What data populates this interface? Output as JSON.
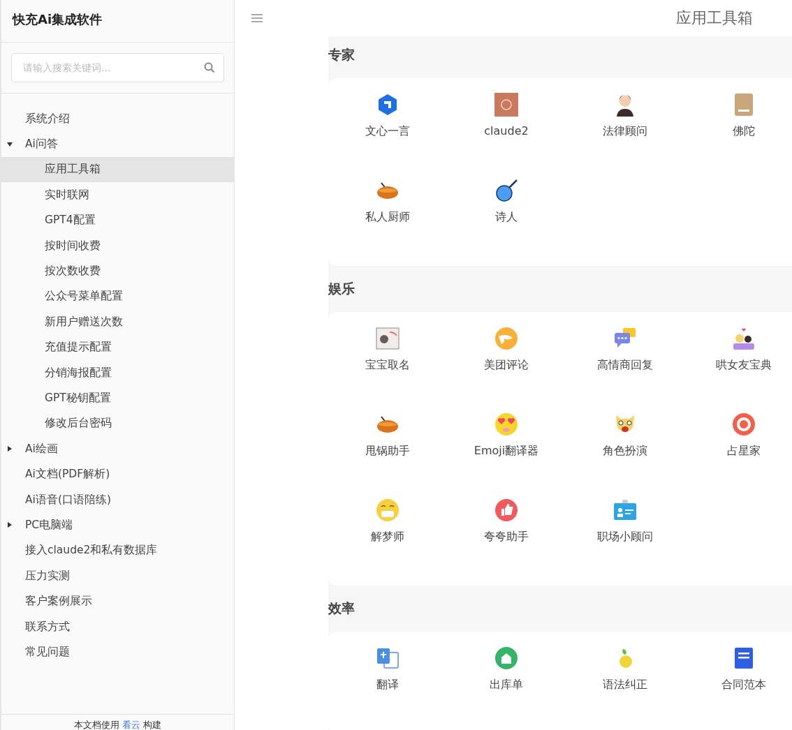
{
  "brand": "快充Ai集成软件",
  "search": {
    "placeholder": "请输入搜索关键词..."
  },
  "nav": [
    {
      "kind": "link",
      "label": "系统介绍",
      "selected": false
    },
    {
      "kind": "group",
      "label": "Ai问答",
      "selected": false,
      "expanded": true,
      "children": [
        {
          "label": "应用工具箱",
          "selected": true
        },
        {
          "label": "实时联网",
          "selected": false
        },
        {
          "label": "GPT4配置",
          "selected": false
        },
        {
          "label": "按时间收费",
          "selected": false
        },
        {
          "label": "按次数收费",
          "selected": false
        },
        {
          "label": "公众号菜单配置",
          "selected": false
        },
        {
          "label": "新用户赠送次数",
          "selected": false
        },
        {
          "label": "充值提示配置",
          "selected": false
        },
        {
          "label": "分销海报配置",
          "selected": false
        },
        {
          "label": "GPT秘钥配置",
          "selected": false
        },
        {
          "label": "修改后台密码",
          "selected": false
        }
      ]
    },
    {
      "kind": "group",
      "label": "Ai绘画",
      "selected": false,
      "expanded": false
    },
    {
      "kind": "link",
      "label": "Ai文档(PDF解析)",
      "selected": false
    },
    {
      "kind": "link",
      "label": "Ai语音(口语陪练)",
      "selected": false
    },
    {
      "kind": "group",
      "label": "PC电脑端",
      "selected": false,
      "expanded": false
    },
    {
      "kind": "link",
      "label": "接入claude2和私有数据库",
      "selected": false
    },
    {
      "kind": "link",
      "label": "压力实测",
      "selected": false
    },
    {
      "kind": "link",
      "label": "客户案例展示",
      "selected": false
    },
    {
      "kind": "link",
      "label": "联系方式",
      "selected": false
    },
    {
      "kind": "link",
      "label": "常见问题",
      "selected": false
    }
  ],
  "footer": {
    "before": "本文档使用",
    "link": "看云",
    "after": "构建"
  },
  "page_title": "应用工具箱",
  "sections": [
    {
      "title": "专家",
      "apps": [
        {
          "label": "文心一言"
        },
        {
          "label": "claude2"
        },
        {
          "label": "法律顾问"
        },
        {
          "label": "佛陀"
        },
        {
          "label": "私人厨师"
        },
        {
          "label": "诗人"
        }
      ]
    },
    {
      "title": "娱乐",
      "apps": [
        {
          "label": "宝宝取名"
        },
        {
          "label": "美团评论"
        },
        {
          "label": "高情商回复"
        },
        {
          "label": "哄女友宝典"
        },
        {
          "label": "甩锅助手"
        },
        {
          "label": "Emoji翻译器"
        },
        {
          "label": "角色扮演"
        },
        {
          "label": "占星家"
        },
        {
          "label": "解梦师"
        },
        {
          "label": "夸夸助手"
        },
        {
          "label": "职场小顾问"
        }
      ]
    },
    {
      "title": "效率",
      "apps": [
        {
          "label": "翻译"
        },
        {
          "label": "出库单"
        },
        {
          "label": "语法纠正"
        },
        {
          "label": "合同范本"
        }
      ]
    }
  ]
}
